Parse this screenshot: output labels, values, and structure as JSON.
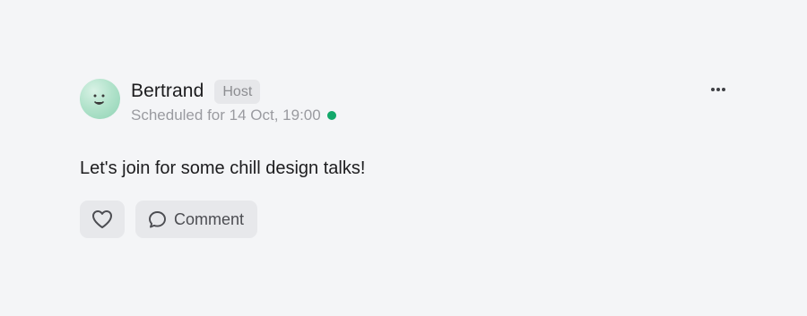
{
  "post": {
    "author": {
      "name": "Bertrand",
      "role_badge": "Host",
      "avatar_icon": "smiley-face-avatar"
    },
    "schedule_text": "Scheduled for 14 Oct, 19:00",
    "status": {
      "state": "online",
      "color": "#12a86a"
    },
    "message": "Let's join for some chill design talks!",
    "actions": {
      "like_icon": "heart-icon",
      "comment_icon": "speech-bubble-icon",
      "comment_label": "Comment"
    },
    "menu_icon": "more-horizontal-icon"
  },
  "colors": {
    "background": "#f4f5f7",
    "button_bg": "#e7e8eb",
    "badge_bg": "#e6e7ea",
    "muted_text": "#9a9ba0",
    "primary_text": "#1c1c1e"
  }
}
